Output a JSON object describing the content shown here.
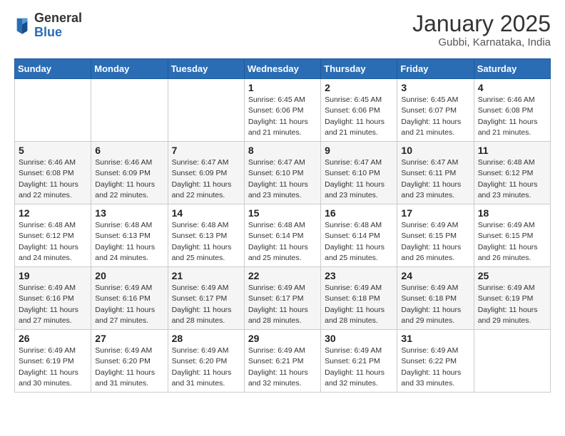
{
  "logo": {
    "general": "General",
    "blue": "Blue"
  },
  "title": "January 2025",
  "subtitle": "Gubbi, Karnataka, India",
  "weekdays": [
    "Sunday",
    "Monday",
    "Tuesday",
    "Wednesday",
    "Thursday",
    "Friday",
    "Saturday"
  ],
  "weeks": [
    [
      {
        "day": "",
        "info": ""
      },
      {
        "day": "",
        "info": ""
      },
      {
        "day": "",
        "info": ""
      },
      {
        "day": "1",
        "info": "Sunrise: 6:45 AM\nSunset: 6:06 PM\nDaylight: 11 hours\nand 21 minutes."
      },
      {
        "day": "2",
        "info": "Sunrise: 6:45 AM\nSunset: 6:06 PM\nDaylight: 11 hours\nand 21 minutes."
      },
      {
        "day": "3",
        "info": "Sunrise: 6:45 AM\nSunset: 6:07 PM\nDaylight: 11 hours\nand 21 minutes."
      },
      {
        "day": "4",
        "info": "Sunrise: 6:46 AM\nSunset: 6:08 PM\nDaylight: 11 hours\nand 21 minutes."
      }
    ],
    [
      {
        "day": "5",
        "info": "Sunrise: 6:46 AM\nSunset: 6:08 PM\nDaylight: 11 hours\nand 22 minutes."
      },
      {
        "day": "6",
        "info": "Sunrise: 6:46 AM\nSunset: 6:09 PM\nDaylight: 11 hours\nand 22 minutes."
      },
      {
        "day": "7",
        "info": "Sunrise: 6:47 AM\nSunset: 6:09 PM\nDaylight: 11 hours\nand 22 minutes."
      },
      {
        "day": "8",
        "info": "Sunrise: 6:47 AM\nSunset: 6:10 PM\nDaylight: 11 hours\nand 23 minutes."
      },
      {
        "day": "9",
        "info": "Sunrise: 6:47 AM\nSunset: 6:10 PM\nDaylight: 11 hours\nand 23 minutes."
      },
      {
        "day": "10",
        "info": "Sunrise: 6:47 AM\nSunset: 6:11 PM\nDaylight: 11 hours\nand 23 minutes."
      },
      {
        "day": "11",
        "info": "Sunrise: 6:48 AM\nSunset: 6:12 PM\nDaylight: 11 hours\nand 23 minutes."
      }
    ],
    [
      {
        "day": "12",
        "info": "Sunrise: 6:48 AM\nSunset: 6:12 PM\nDaylight: 11 hours\nand 24 minutes."
      },
      {
        "day": "13",
        "info": "Sunrise: 6:48 AM\nSunset: 6:13 PM\nDaylight: 11 hours\nand 24 minutes."
      },
      {
        "day": "14",
        "info": "Sunrise: 6:48 AM\nSunset: 6:13 PM\nDaylight: 11 hours\nand 25 minutes."
      },
      {
        "day": "15",
        "info": "Sunrise: 6:48 AM\nSunset: 6:14 PM\nDaylight: 11 hours\nand 25 minutes."
      },
      {
        "day": "16",
        "info": "Sunrise: 6:48 AM\nSunset: 6:14 PM\nDaylight: 11 hours\nand 25 minutes."
      },
      {
        "day": "17",
        "info": "Sunrise: 6:49 AM\nSunset: 6:15 PM\nDaylight: 11 hours\nand 26 minutes."
      },
      {
        "day": "18",
        "info": "Sunrise: 6:49 AM\nSunset: 6:15 PM\nDaylight: 11 hours\nand 26 minutes."
      }
    ],
    [
      {
        "day": "19",
        "info": "Sunrise: 6:49 AM\nSunset: 6:16 PM\nDaylight: 11 hours\nand 27 minutes."
      },
      {
        "day": "20",
        "info": "Sunrise: 6:49 AM\nSunset: 6:16 PM\nDaylight: 11 hours\nand 27 minutes."
      },
      {
        "day": "21",
        "info": "Sunrise: 6:49 AM\nSunset: 6:17 PM\nDaylight: 11 hours\nand 28 minutes."
      },
      {
        "day": "22",
        "info": "Sunrise: 6:49 AM\nSunset: 6:17 PM\nDaylight: 11 hours\nand 28 minutes."
      },
      {
        "day": "23",
        "info": "Sunrise: 6:49 AM\nSunset: 6:18 PM\nDaylight: 11 hours\nand 28 minutes."
      },
      {
        "day": "24",
        "info": "Sunrise: 6:49 AM\nSunset: 6:18 PM\nDaylight: 11 hours\nand 29 minutes."
      },
      {
        "day": "25",
        "info": "Sunrise: 6:49 AM\nSunset: 6:19 PM\nDaylight: 11 hours\nand 29 minutes."
      }
    ],
    [
      {
        "day": "26",
        "info": "Sunrise: 6:49 AM\nSunset: 6:19 PM\nDaylight: 11 hours\nand 30 minutes."
      },
      {
        "day": "27",
        "info": "Sunrise: 6:49 AM\nSunset: 6:20 PM\nDaylight: 11 hours\nand 31 minutes."
      },
      {
        "day": "28",
        "info": "Sunrise: 6:49 AM\nSunset: 6:20 PM\nDaylight: 11 hours\nand 31 minutes."
      },
      {
        "day": "29",
        "info": "Sunrise: 6:49 AM\nSunset: 6:21 PM\nDaylight: 11 hours\nand 32 minutes."
      },
      {
        "day": "30",
        "info": "Sunrise: 6:49 AM\nSunset: 6:21 PM\nDaylight: 11 hours\nand 32 minutes."
      },
      {
        "day": "31",
        "info": "Sunrise: 6:49 AM\nSunset: 6:22 PM\nDaylight: 11 hours\nand 33 minutes."
      },
      {
        "day": "",
        "info": ""
      }
    ]
  ]
}
